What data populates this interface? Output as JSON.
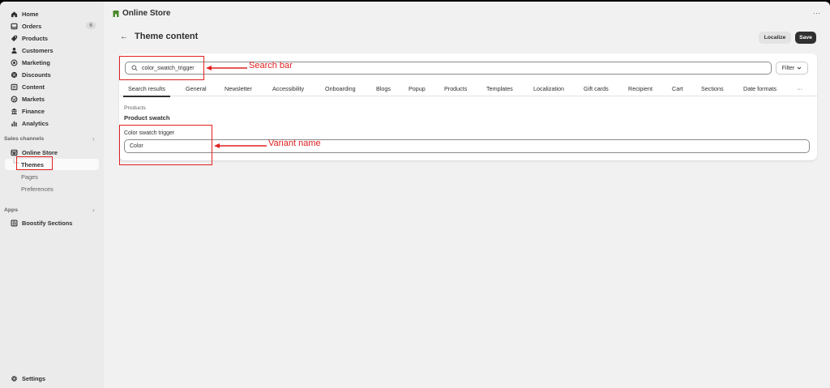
{
  "sidebar": {
    "items": [
      {
        "label": "Home",
        "icon": "home-icon"
      },
      {
        "label": "Orders",
        "icon": "orders-icon",
        "badge": "6"
      },
      {
        "label": "Products",
        "icon": "tag-icon"
      },
      {
        "label": "Customers",
        "icon": "person-icon"
      },
      {
        "label": "Marketing",
        "icon": "target-icon"
      },
      {
        "label": "Discounts",
        "icon": "discount-icon"
      },
      {
        "label": "Content",
        "icon": "content-icon"
      },
      {
        "label": "Markets",
        "icon": "globe-icon"
      },
      {
        "label": "Finance",
        "icon": "bank-icon"
      },
      {
        "label": "Analytics",
        "icon": "bar-chart-icon"
      }
    ],
    "sales_channels_label": "Sales channels",
    "online_store_label": "Online Store",
    "sub_items": [
      "Themes",
      "Pages",
      "Preferences"
    ],
    "apps_label": "Apps",
    "app_item": "Boostify Sections",
    "settings_label": "Settings"
  },
  "header": {
    "store_title": "Online Store",
    "more": "···"
  },
  "page": {
    "title": "Theme content",
    "back_icon": "←",
    "localize_label": "Localize",
    "save_label": "Save"
  },
  "search": {
    "value": "color_swatch_trigger",
    "filter_label": "Filter"
  },
  "tabs": [
    "Search results",
    "General",
    "Newsletter",
    "Accessibility",
    "Onboarding",
    "Blogs",
    "Popup",
    "Products",
    "Templates",
    "Localization",
    "Gift cards",
    "Recipient",
    "Cart",
    "Sections",
    "Date formats",
    "···"
  ],
  "result": {
    "group_label": "Products",
    "group_title": "Product swatch",
    "field_label": "Color swatch trigger",
    "field_value": "Color"
  },
  "annotations": {
    "search_bar": "Search bar",
    "variant_name": "Variant name"
  },
  "colors": {
    "annotation": "#e02020",
    "logo_green": "#4c8a2e",
    "save_bg": "#303030"
  }
}
